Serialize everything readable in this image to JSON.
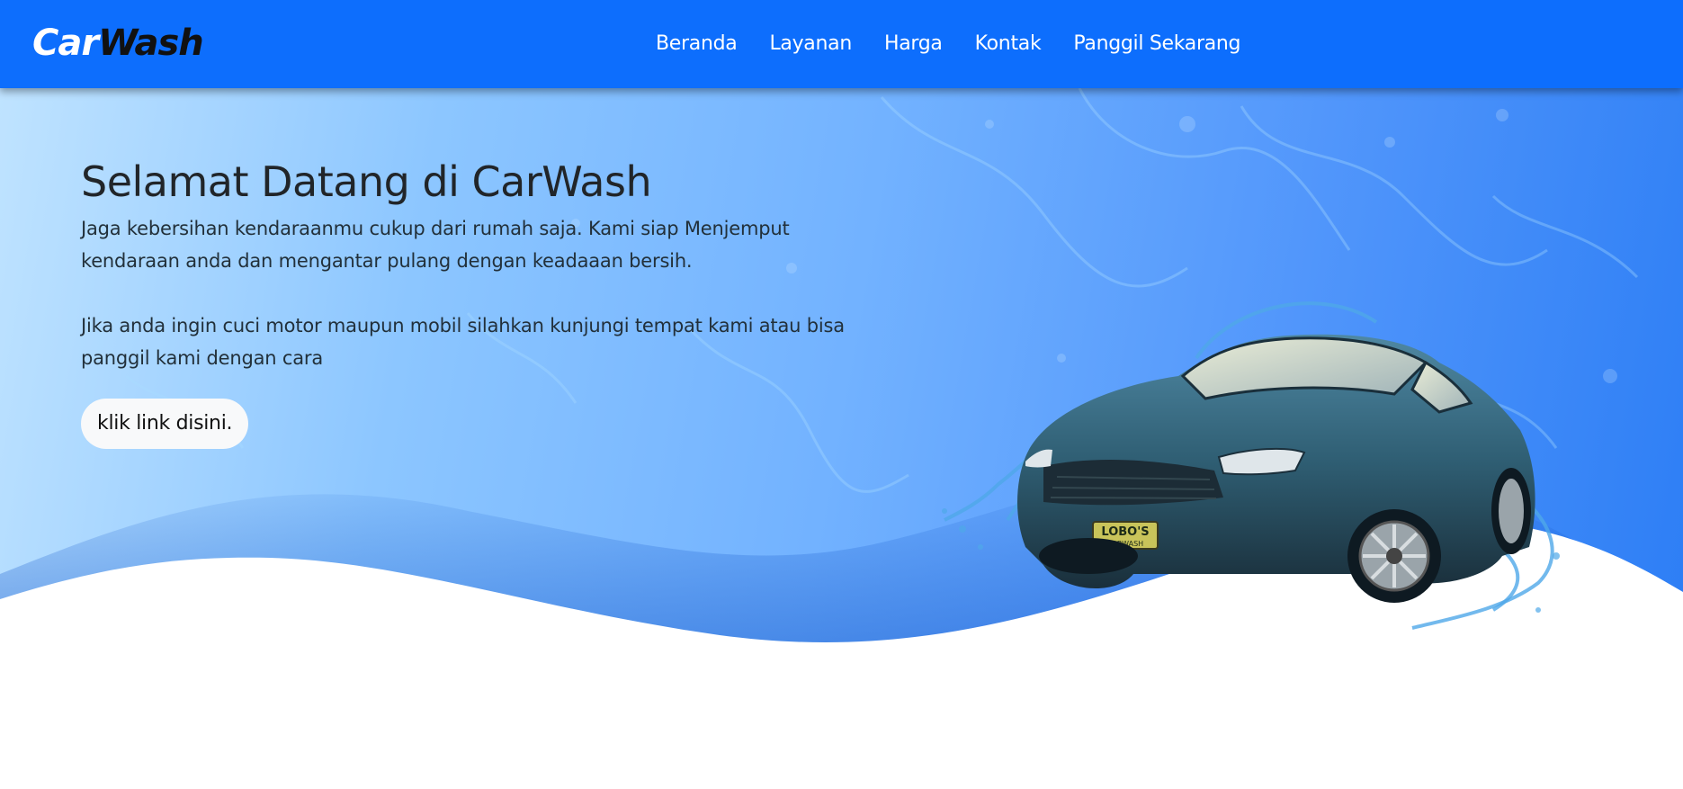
{
  "brand": {
    "part1": "Car",
    "part2": "Wash"
  },
  "nav": {
    "items": [
      {
        "label": "Beranda"
      },
      {
        "label": "Layanan"
      },
      {
        "label": "Harga"
      },
      {
        "label": "Kontak"
      },
      {
        "label": "Panggil Sekarang"
      }
    ]
  },
  "hero": {
    "title": "Selamat Datang di CarWash",
    "paragraph1_line1": "Jaga kebersihan kendaraanmu cukup dari rumah saja. Kami siap Menjemput",
    "paragraph1_line2": "kendaraan anda dan mengantar pulang dengan keadaaan bersih.",
    "paragraph2_line1": "Jika anda ingin cuci motor maupun mobil silahkan kunjungi tempat kami atau bisa",
    "paragraph2_line2": "panggil kami dengan cara",
    "cta_label": "klik link disini.",
    "car_plate_text1": "LOBO'S",
    "car_plate_text2": "CARWASH"
  },
  "colors": {
    "navbar": "#0d6efd",
    "hero_light": "#bfe3ff",
    "hero_dark": "#2d7ef5",
    "car_body": "#2f5e73"
  }
}
